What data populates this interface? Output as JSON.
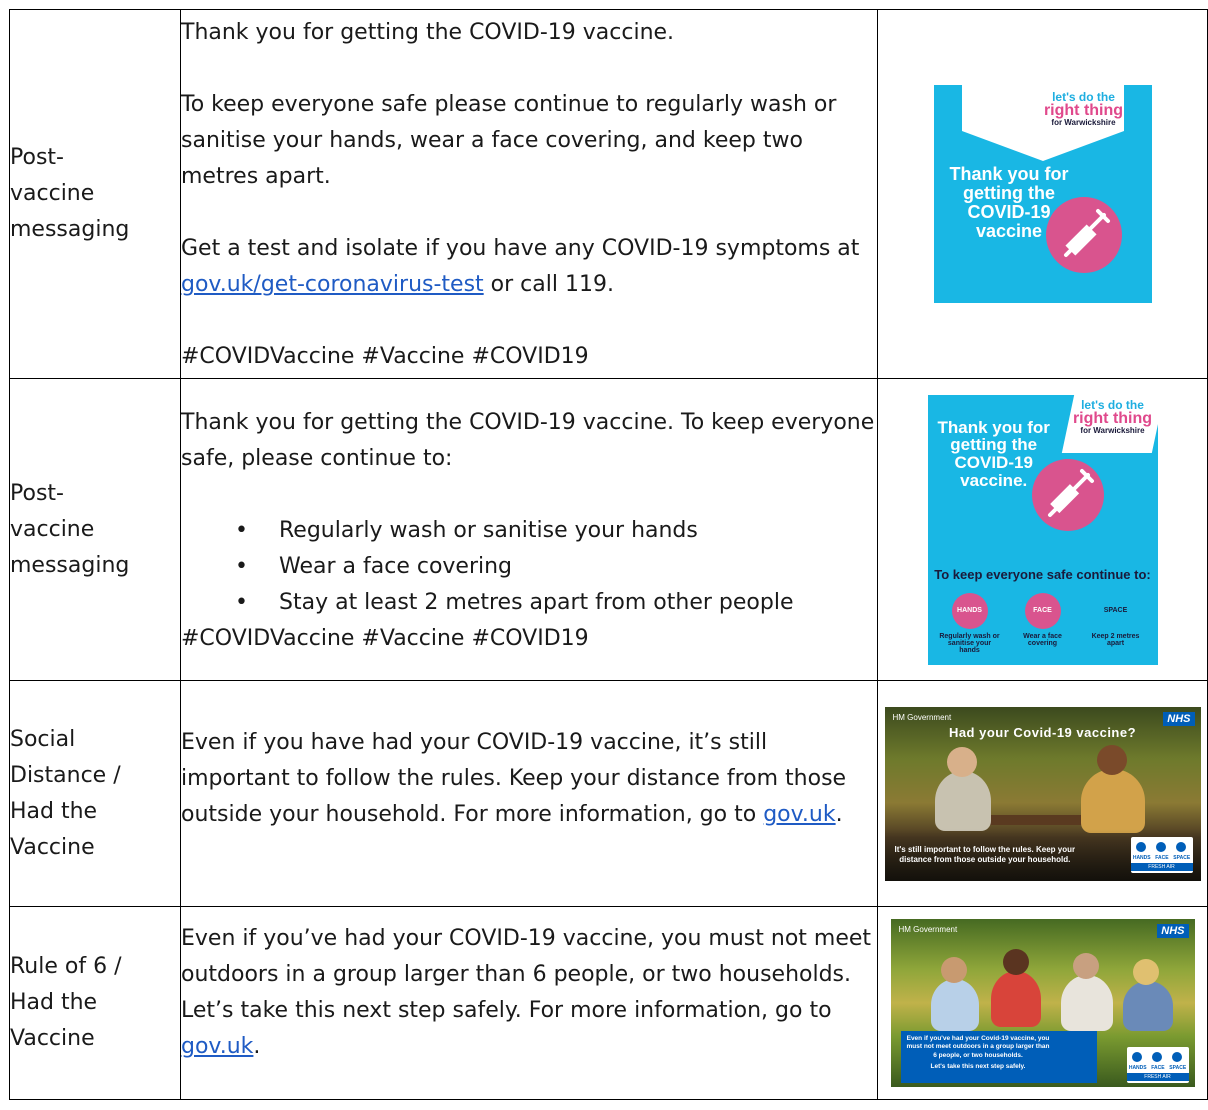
{
  "rows": [
    {
      "label": "Post-vaccine messaging",
      "label_lines": [
        "Post-",
        "vaccine",
        "messaging"
      ],
      "paragraphs": [
        "Thank you for getting the COVID-19 vaccine.",
        "To keep everyone safe please continue to regularly wash or sanitise your hands, wear a face covering, and keep two metres apart.",
        "Get a test and isolate if you have any COVID-19 symptoms at ",
        "#COVIDVaccine #Vaccine #COVID19"
      ],
      "link": "gov.uk/get-coronavirus-test",
      "link_after": " or call 119.",
      "poster": {
        "line1": "let's do the",
        "line2": "right thing",
        "line3": "for Warwickshire",
        "title_lines": [
          "Thank you for",
          "getting the",
          "COVID-19",
          "vaccine"
        ]
      }
    },
    {
      "label_lines": [
        "Post-",
        "vaccine",
        "messaging"
      ],
      "intro": "Thank you for getting the COVID-19 vaccine. To keep everyone safe, please continue to:",
      "bullets": [
        "Regularly wash or sanitise your hands",
        "Wear a face covering",
        "Stay at least 2 metres apart from other people"
      ],
      "hashtags": "#COVIDVaccine #Vaccine #COVID19",
      "poster": {
        "line1": "let's do the",
        "line2": "right thing",
        "line3": "for Warwickshire",
        "title_lines": [
          "Thank you for",
          "getting the",
          "COVID-19",
          "vaccine."
        ],
        "band": "To keep everyone safe continue to:",
        "icons": [
          "HANDS",
          "FACE",
          "SPACE"
        ],
        "captions": [
          "Regularly wash or sanitise your hands",
          "Wear a face covering",
          "Keep 2 metres apart"
        ]
      }
    },
    {
      "label_lines": [
        "Social",
        "Distance /",
        "Had the",
        "Vaccine"
      ],
      "text": "Even if you have had your COVID-19 vaccine, it’s still important to follow the rules. Keep your distance from those outside your household. For more information, go to ",
      "link": "gov.uk",
      "text_after": ".",
      "photo": {
        "gov": "HM Government",
        "nhs": "NHS",
        "headline": "Had your Covid-19 vaccine?",
        "caption_lines": [
          "It's still important to follow the rules. Keep your",
          "distance from those outside your household."
        ],
        "hfs": [
          "HANDS",
          "FACE",
          "SPACE"
        ],
        "fresh": "FRESH AIR"
      }
    },
    {
      "label_lines": [
        "Rule of 6 /",
        "Had the",
        "Vaccine"
      ],
      "text": "Even if you’ve had your COVID-19 vaccine, you must not meet outdoors in a group larger than 6 people, or two households. Let’s take this next step safely. For more information, go to ",
      "link": "gov.uk",
      "text_after": ".",
      "photo": {
        "gov": "HM Government",
        "nhs": "NHS",
        "caption_lines": [
          "Even if you've had your Covid-19 vaccine, you",
          "must not meet outdoors in a group larger than",
          "6 people, or two households.",
          "Let's take this next step safely."
        ],
        "hfs": [
          "HANDS",
          "FACE",
          "SPACE"
        ],
        "fresh": "FRESH AIR"
      }
    }
  ]
}
